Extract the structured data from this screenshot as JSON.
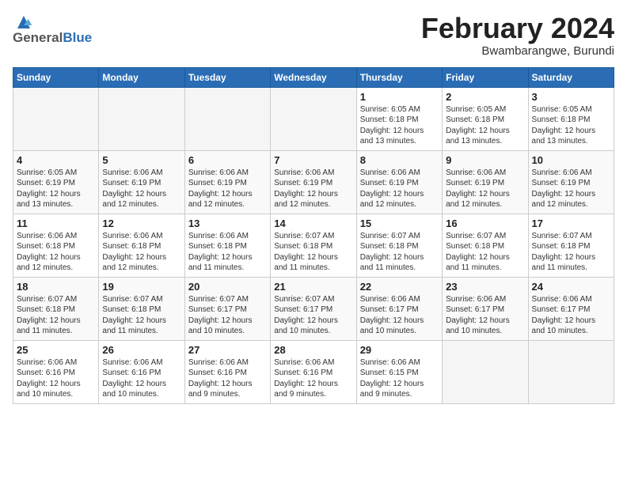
{
  "header": {
    "logo_line1": "General",
    "logo_line2": "Blue",
    "month_title": "February 2024",
    "subtitle": "Bwambarangwe, Burundi"
  },
  "days_of_week": [
    "Sunday",
    "Monday",
    "Tuesday",
    "Wednesday",
    "Thursday",
    "Friday",
    "Saturday"
  ],
  "weeks": [
    [
      {
        "day": "",
        "text": ""
      },
      {
        "day": "",
        "text": ""
      },
      {
        "day": "",
        "text": ""
      },
      {
        "day": "",
        "text": ""
      },
      {
        "day": "1",
        "text": "Sunrise: 6:05 AM\nSunset: 6:18 PM\nDaylight: 12 hours\nand 13 minutes."
      },
      {
        "day": "2",
        "text": "Sunrise: 6:05 AM\nSunset: 6:18 PM\nDaylight: 12 hours\nand 13 minutes."
      },
      {
        "day": "3",
        "text": "Sunrise: 6:05 AM\nSunset: 6:18 PM\nDaylight: 12 hours\nand 13 minutes."
      }
    ],
    [
      {
        "day": "4",
        "text": "Sunrise: 6:05 AM\nSunset: 6:19 PM\nDaylight: 12 hours\nand 13 minutes."
      },
      {
        "day": "5",
        "text": "Sunrise: 6:06 AM\nSunset: 6:19 PM\nDaylight: 12 hours\nand 12 minutes."
      },
      {
        "day": "6",
        "text": "Sunrise: 6:06 AM\nSunset: 6:19 PM\nDaylight: 12 hours\nand 12 minutes."
      },
      {
        "day": "7",
        "text": "Sunrise: 6:06 AM\nSunset: 6:19 PM\nDaylight: 12 hours\nand 12 minutes."
      },
      {
        "day": "8",
        "text": "Sunrise: 6:06 AM\nSunset: 6:19 PM\nDaylight: 12 hours\nand 12 minutes."
      },
      {
        "day": "9",
        "text": "Sunrise: 6:06 AM\nSunset: 6:19 PM\nDaylight: 12 hours\nand 12 minutes."
      },
      {
        "day": "10",
        "text": "Sunrise: 6:06 AM\nSunset: 6:19 PM\nDaylight: 12 hours\nand 12 minutes."
      }
    ],
    [
      {
        "day": "11",
        "text": "Sunrise: 6:06 AM\nSunset: 6:18 PM\nDaylight: 12 hours\nand 12 minutes."
      },
      {
        "day": "12",
        "text": "Sunrise: 6:06 AM\nSunset: 6:18 PM\nDaylight: 12 hours\nand 12 minutes."
      },
      {
        "day": "13",
        "text": "Sunrise: 6:06 AM\nSunset: 6:18 PM\nDaylight: 12 hours\nand 11 minutes."
      },
      {
        "day": "14",
        "text": "Sunrise: 6:07 AM\nSunset: 6:18 PM\nDaylight: 12 hours\nand 11 minutes."
      },
      {
        "day": "15",
        "text": "Sunrise: 6:07 AM\nSunset: 6:18 PM\nDaylight: 12 hours\nand 11 minutes."
      },
      {
        "day": "16",
        "text": "Sunrise: 6:07 AM\nSunset: 6:18 PM\nDaylight: 12 hours\nand 11 minutes."
      },
      {
        "day": "17",
        "text": "Sunrise: 6:07 AM\nSunset: 6:18 PM\nDaylight: 12 hours\nand 11 minutes."
      }
    ],
    [
      {
        "day": "18",
        "text": "Sunrise: 6:07 AM\nSunset: 6:18 PM\nDaylight: 12 hours\nand 11 minutes."
      },
      {
        "day": "19",
        "text": "Sunrise: 6:07 AM\nSunset: 6:18 PM\nDaylight: 12 hours\nand 11 minutes."
      },
      {
        "day": "20",
        "text": "Sunrise: 6:07 AM\nSunset: 6:17 PM\nDaylight: 12 hours\nand 10 minutes."
      },
      {
        "day": "21",
        "text": "Sunrise: 6:07 AM\nSunset: 6:17 PM\nDaylight: 12 hours\nand 10 minutes."
      },
      {
        "day": "22",
        "text": "Sunrise: 6:06 AM\nSunset: 6:17 PM\nDaylight: 12 hours\nand 10 minutes."
      },
      {
        "day": "23",
        "text": "Sunrise: 6:06 AM\nSunset: 6:17 PM\nDaylight: 12 hours\nand 10 minutes."
      },
      {
        "day": "24",
        "text": "Sunrise: 6:06 AM\nSunset: 6:17 PM\nDaylight: 12 hours\nand 10 minutes."
      }
    ],
    [
      {
        "day": "25",
        "text": "Sunrise: 6:06 AM\nSunset: 6:16 PM\nDaylight: 12 hours\nand 10 minutes."
      },
      {
        "day": "26",
        "text": "Sunrise: 6:06 AM\nSunset: 6:16 PM\nDaylight: 12 hours\nand 10 minutes."
      },
      {
        "day": "27",
        "text": "Sunrise: 6:06 AM\nSunset: 6:16 PM\nDaylight: 12 hours\nand 9 minutes."
      },
      {
        "day": "28",
        "text": "Sunrise: 6:06 AM\nSunset: 6:16 PM\nDaylight: 12 hours\nand 9 minutes."
      },
      {
        "day": "29",
        "text": "Sunrise: 6:06 AM\nSunset: 6:15 PM\nDaylight: 12 hours\nand 9 minutes."
      },
      {
        "day": "",
        "text": ""
      },
      {
        "day": "",
        "text": ""
      }
    ]
  ]
}
